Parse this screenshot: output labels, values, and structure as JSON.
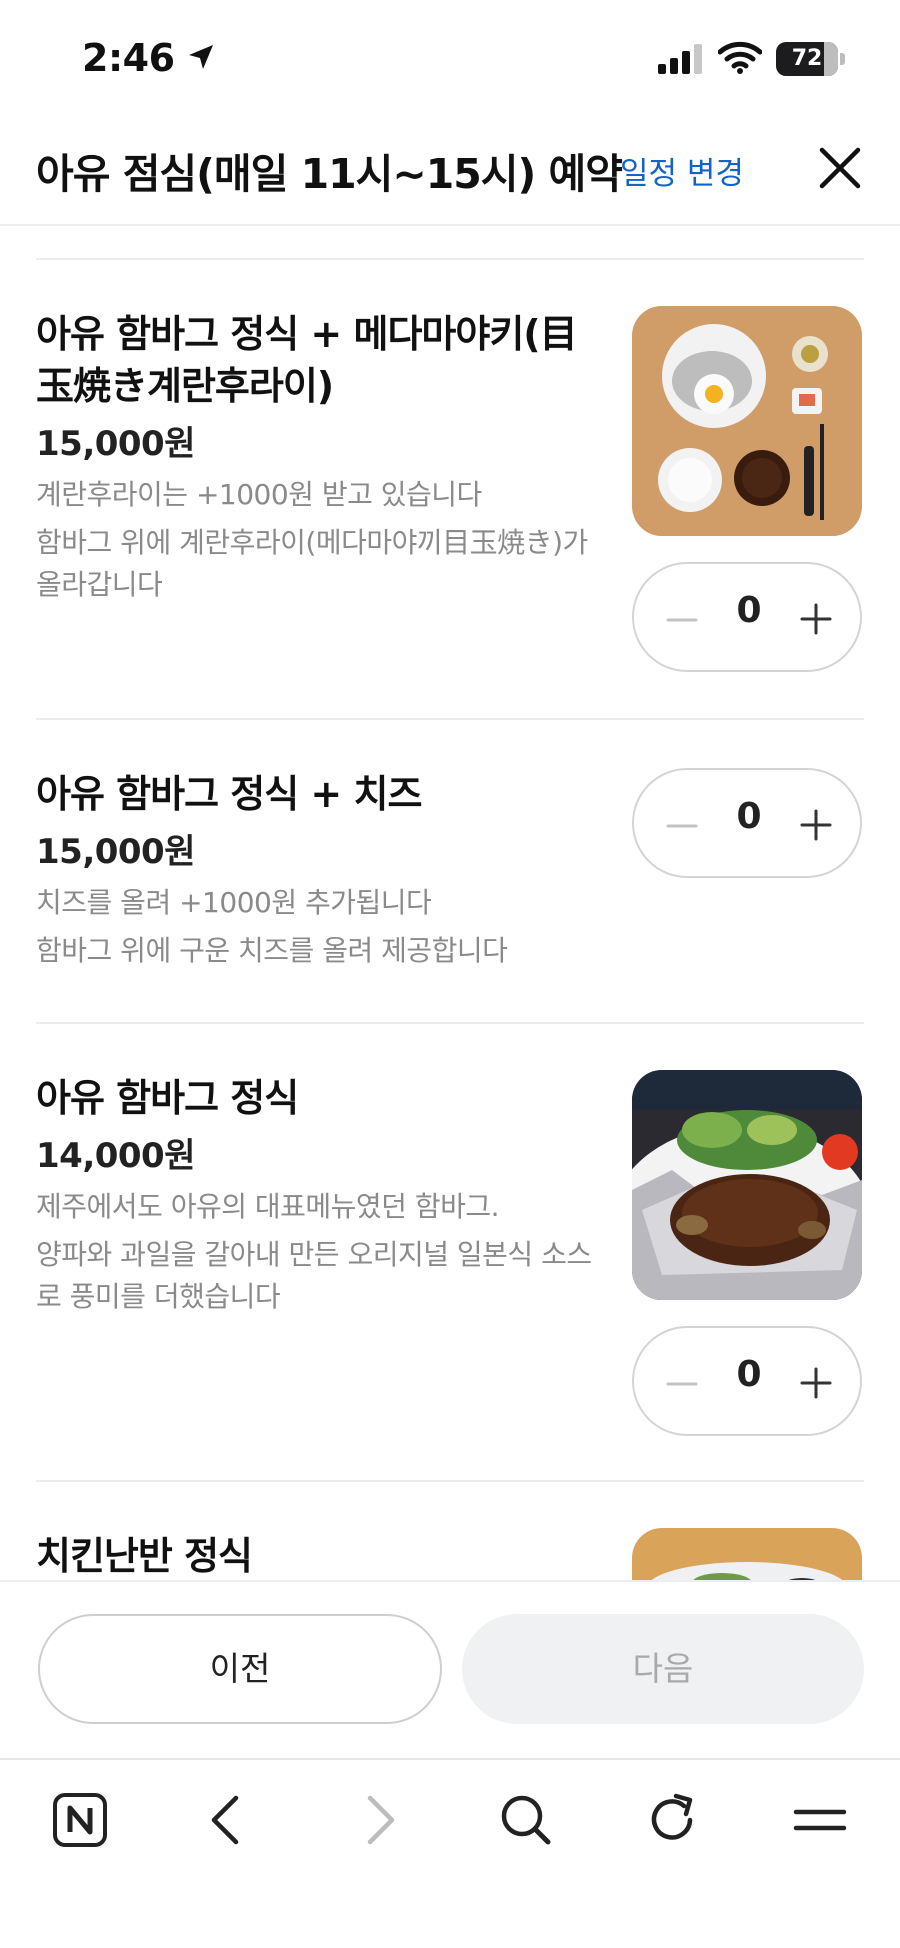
{
  "status": {
    "time": "2:46",
    "battery": "72"
  },
  "header": {
    "title": "아유 점심(매일 11시~15시) 예약",
    "change_link": "일정 변경"
  },
  "items": [
    {
      "name": "아유 함바그 정식 + 메다마야키(目玉焼き계란후라이)",
      "price": "15,000원",
      "desc": [
        "계란후라이는 +1000원 받고 있습니다",
        "함바그 위에 계란후라이(메다마야끼目玉焼き)가 올라갑니다"
      ],
      "qty": "0"
    },
    {
      "name": "아유 함바그 정식 + 치즈",
      "price": "15,000원",
      "desc": [
        "치즈를 올려 +1000원 추가됩니다",
        "함바그 위에 구운 치즈를 올려 제공합니다"
      ],
      "qty": "0"
    },
    {
      "name": "아유 함바그 정식",
      "price": "14,000원",
      "desc": [
        "제주에서도 아유의 대표메뉴였던 함바그.",
        "양파와 과일을 갈아내 만든 오리지널 일본식 소스로 풍미를 더했습니다"
      ],
      "qty": "0"
    },
    {
      "name": "치킨난반 정식"
    }
  ],
  "actions": {
    "prev": "이전",
    "next": "다음"
  },
  "icons": {
    "n_logo": "naver-n-icon",
    "back": "chevron-left-icon",
    "forward": "chevron-right-icon",
    "search": "search-icon",
    "reload": "reload-icon",
    "menu": "menu-icon"
  },
  "colors": {
    "link": "#1464c8",
    "disabled_bg": "#f0f1f3",
    "desc": "#8a8a8a"
  }
}
